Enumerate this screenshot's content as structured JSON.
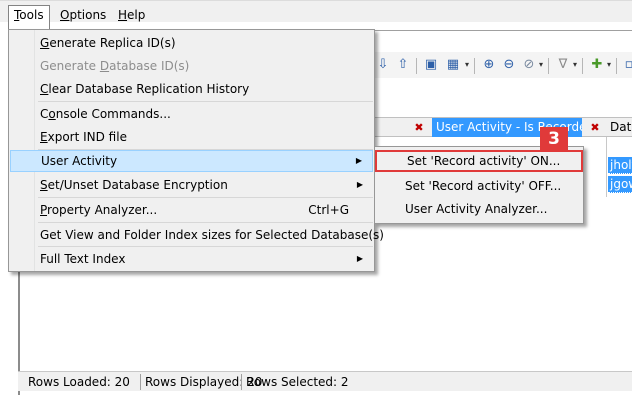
{
  "menubar": {
    "items": [
      {
        "label": "Tools",
        "mnemonic": "T",
        "rest": "ools"
      },
      {
        "label": "Options",
        "mnemonic": "O",
        "rest": "ptions"
      },
      {
        "label": "Help",
        "mnemonic": "H",
        "rest": "elp"
      }
    ]
  },
  "tools_menu": {
    "items": [
      {
        "pre": "",
        "mn": "G",
        "post": "enerate Replica ID(s)",
        "disabled": false
      },
      {
        "pre": "Generate ",
        "mn": "D",
        "post": "atabase ID(s)",
        "disabled": true
      },
      {
        "pre": "",
        "mn": "C",
        "post": "lear Database Replication History",
        "disabled": false
      },
      {
        "pre": "C",
        "mn": "o",
        "post": "nsole Commands...",
        "disabled": false
      },
      {
        "pre": "",
        "mn": "E",
        "post": "xport IND file",
        "disabled": false
      },
      {
        "pre": "User Activity",
        "mn": "",
        "post": "",
        "highlighted": true
      },
      {
        "pre": "",
        "mn": "S",
        "post": "et/Unset Database Encryption"
      },
      {
        "pre": "",
        "mn": "P",
        "post": "roperty Analyzer...",
        "shortcut": "Ctrl+G"
      },
      {
        "pre": "Get View and Folder Index sizes for Selected Database(s)",
        "mn": "",
        "post": ""
      },
      {
        "pre": "Full Text Index",
        "mn": "",
        "post": ""
      }
    ]
  },
  "user_activity_submenu": {
    "items": [
      {
        "label": "Set 'Record activity' ON..."
      },
      {
        "label": "Set 'Record activity' OFF..."
      },
      {
        "label": "User Activity Analyzer..."
      }
    ],
    "step_badge": "3"
  },
  "grid": {
    "header_highlighted": "User Activity - Is Recorded",
    "header_next": "Data",
    "rows": [
      "jholt",
      "jgow"
    ]
  },
  "status_bar": {
    "rows_loaded": "Rows Loaded: 20",
    "rows_displayed": "Rows Displayed: 20",
    "rows_selected": "Rows Selected: 2"
  },
  "colors": {
    "highlight": "#cce8ff",
    "selection": "#3399ff",
    "callout": "#e03a3a"
  }
}
